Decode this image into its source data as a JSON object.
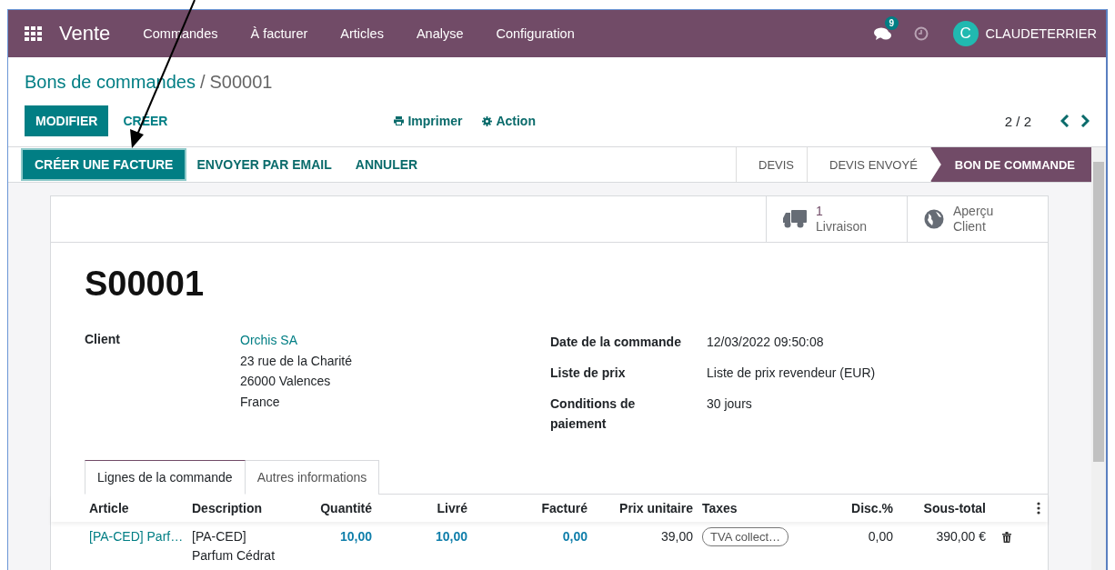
{
  "navbar": {
    "app_name": "Vente",
    "menu": [
      "Commandes",
      "À facturer",
      "Articles",
      "Analyse",
      "Configuration"
    ],
    "messages_badge": "9",
    "user": {
      "initial": "C",
      "name": "CLAUDETERRIER"
    }
  },
  "breadcrumb": {
    "parent": "Bons de commandes",
    "separator": "/",
    "current": "S00001"
  },
  "control_buttons": [
    {
      "label": "MODIFIER",
      "kind": "primary"
    },
    {
      "label": "CRÉER",
      "kind": "link"
    }
  ],
  "actions": [
    {
      "label": "Imprimer",
      "kind": "print"
    },
    {
      "label": "Action",
      "kind": "gear"
    }
  ],
  "pager": "2 / 2",
  "status_buttons": [
    {
      "label": "CRÉER UNE FACTURE",
      "highlighted": true
    },
    {
      "label": "ENVOYER PAR EMAIL",
      "highlighted": false
    },
    {
      "label": "ANNULER",
      "highlighted": false
    }
  ],
  "stages": [
    {
      "label": "DEVIS",
      "selected": false
    },
    {
      "label": "DEVIS ENVOYÉ",
      "selected": false
    },
    {
      "label": "BON DE COMMANDE",
      "selected": true
    }
  ],
  "smart_buttons": [
    {
      "kind": "delivery",
      "lines": [
        "1",
        "Livraison"
      ]
    },
    {
      "kind": "preview",
      "lines": [
        "Aperçu",
        "Client"
      ]
    }
  ],
  "title": "S00001",
  "client": {
    "label": "Client",
    "name": "Orchis SA",
    "address": [
      "23 rue de la Charité",
      "26000 Valences",
      "France"
    ]
  },
  "fields": [
    {
      "label": "Date de la commande",
      "value": "12/03/2022 09:50:08"
    },
    {
      "label": "Liste de prix",
      "value": "Liste de prix revendeur (EUR)"
    },
    {
      "label": "Conditions de paiement",
      "value": "30 jours"
    }
  ],
  "tabs": [
    {
      "label": "Lignes de la commande",
      "selected": true
    },
    {
      "label": "Autres informations",
      "selected": false
    }
  ],
  "table": {
    "columns": [
      "Article",
      "Description",
      "Quantité",
      "Livré",
      "Facturé",
      "Prix unitaire",
      "Taxes",
      "Disc.%",
      "Sous-total"
    ],
    "rows": [
      {
        "article": "[PA-CED] Parf…",
        "description": [
          "[PA-CED]",
          "Parfum Cédrat"
        ],
        "quantity": "10,00",
        "delivered": "10,00",
        "invoiced": "0,00",
        "unit_price": "39,00",
        "taxes": [
          "TVA collect…"
        ],
        "discount": "0,00",
        "subtotal": "390,00 €"
      }
    ]
  }
}
